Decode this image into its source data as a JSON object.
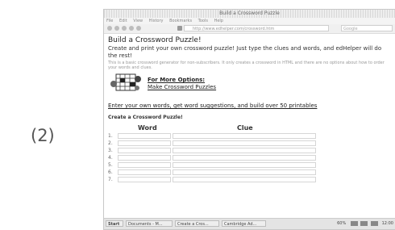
{
  "figure_label": "(2)",
  "window": {
    "title": "Build a Crossword Puzzle"
  },
  "menubar": {
    "items": [
      "File",
      "Edit",
      "View",
      "History",
      "Bookmarks",
      "Tools",
      "Help"
    ]
  },
  "address": {
    "url": "http://www.edhelper.com/crossword.htm"
  },
  "search": {
    "placeholder": "Google"
  },
  "page": {
    "heading": "Build a Crossword Puzzle!",
    "intro": "Create and print your own crossword puzzle! Just type the clues and words, and edHelper will do the rest!",
    "subtext": "This is a basic crossword generator for non-subscribers. It only creates a crossword in HTML and there are no options about how to order your words and clues.",
    "more_options": "For More Options:",
    "make_link": "Make Crossword Puzzles",
    "enter_link": "Enter your own words, get word suggestions, and build over 50 printables",
    "create_heading": "Create a Crossword Puzzle!",
    "columns": {
      "word": "Word",
      "clue": "Clue"
    },
    "rows": [
      "1.",
      "2.",
      "3.",
      "4.",
      "5.",
      "6.",
      "7."
    ]
  },
  "taskbar": {
    "start": "Start",
    "items": [
      "Documents - M...",
      "Create a Cros...",
      "Cambridge Ad..."
    ],
    "percent": "60%",
    "clock": "12:00"
  }
}
